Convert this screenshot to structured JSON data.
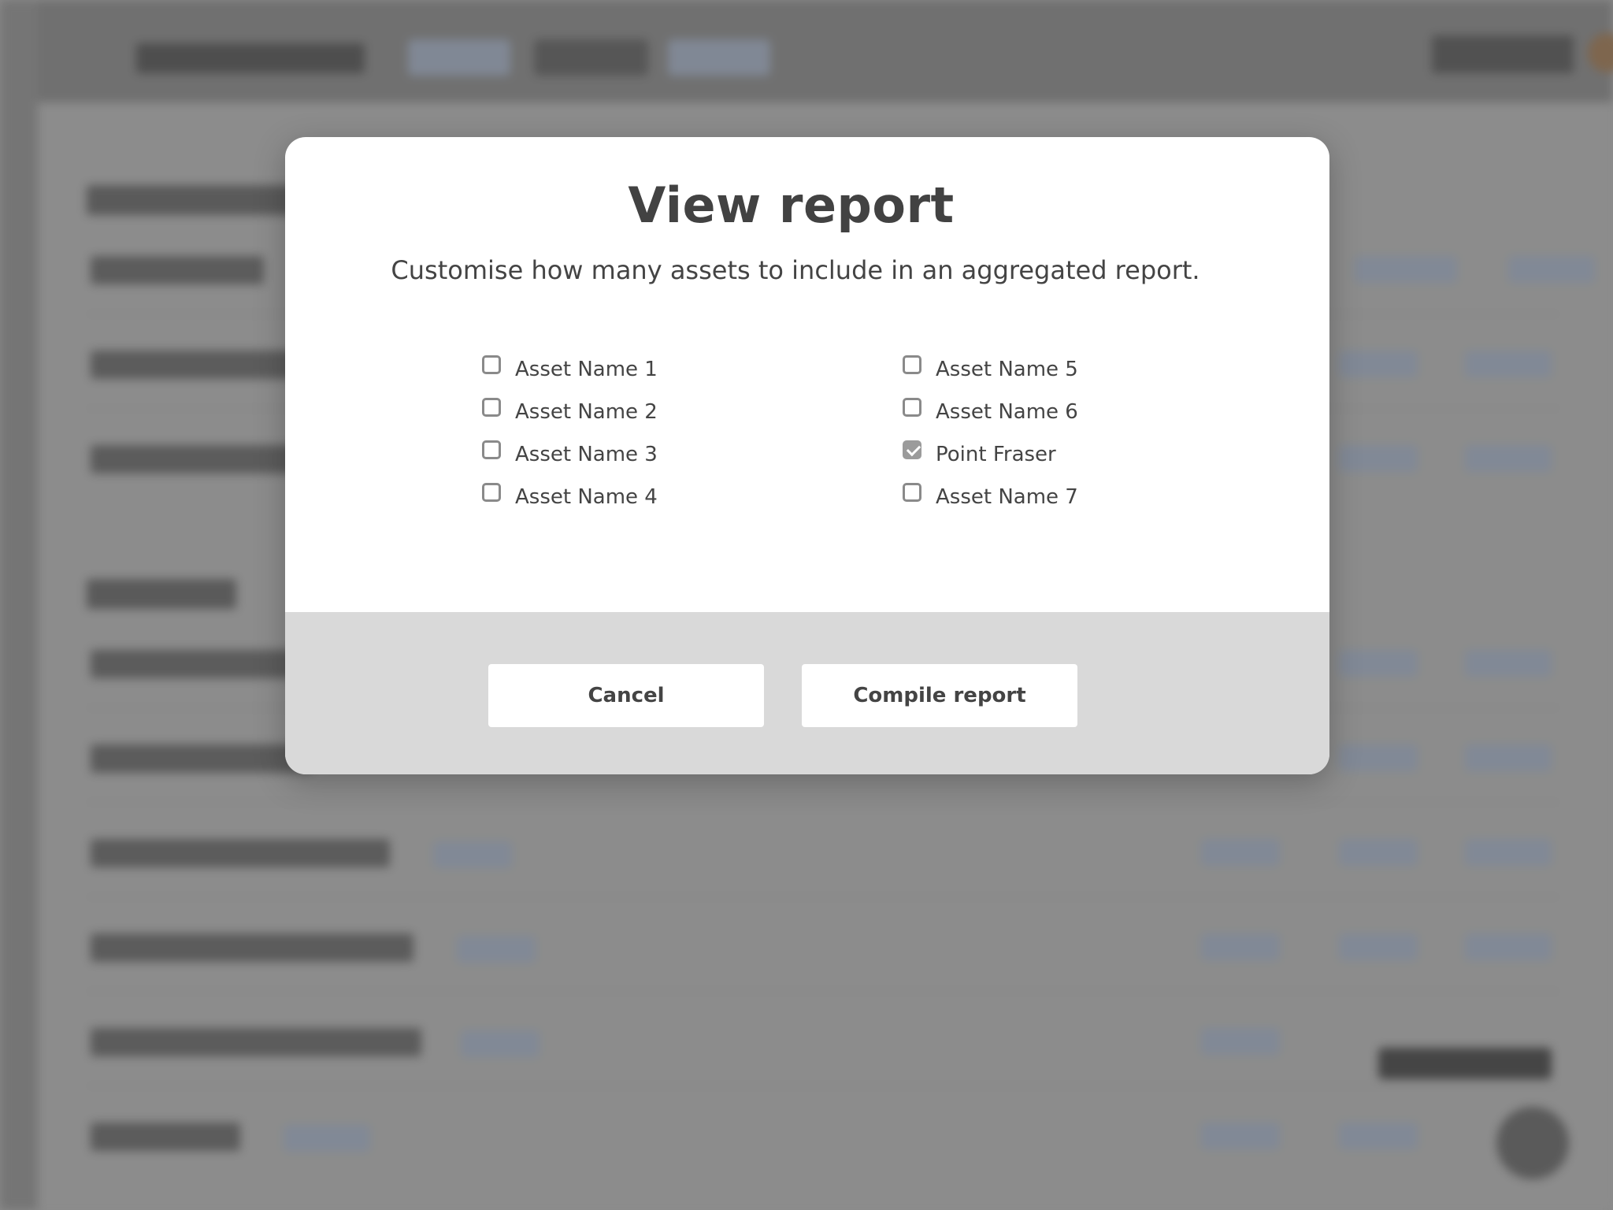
{
  "modal": {
    "title": "View report",
    "subtitle": "Customise how many assets to include in an aggregated report.",
    "options_left": [
      {
        "label": "Asset Name 1",
        "checked": false
      },
      {
        "label": "Asset Name 2",
        "checked": false
      },
      {
        "label": "Asset Name 3",
        "checked": false
      },
      {
        "label": "Asset Name 4",
        "checked": false
      }
    ],
    "options_right": [
      {
        "label": "Asset Name 5",
        "checked": false
      },
      {
        "label": "Asset Name 6",
        "checked": false
      },
      {
        "label": "Point Fraser",
        "checked": true
      },
      {
        "label": "Asset Name 7",
        "checked": false
      }
    ],
    "cancel_label": "Cancel",
    "compile_label": "Compile report"
  },
  "colors": {
    "modal_bg": "#ffffff",
    "footer_bg": "#d9d9d9",
    "text": "#444444",
    "checkbox_border": "#8a8a8a",
    "checkbox_checked": "#9b9b9b",
    "nav_accent": "#8d97a8",
    "avatar": "#8a6a4a"
  }
}
